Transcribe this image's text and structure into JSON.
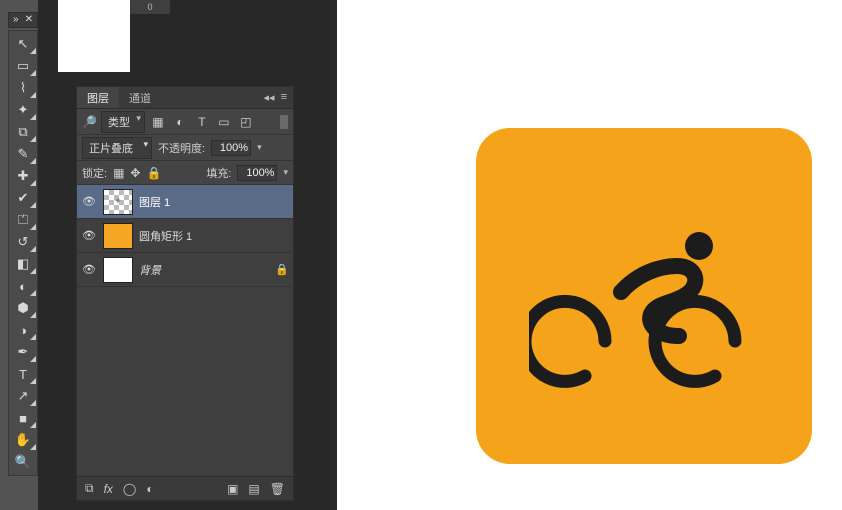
{
  "tabstrip": {
    "close": "✕",
    "arrow": "»"
  },
  "ruler": {
    "mark": "0"
  },
  "tools": [
    {
      "name": "move-tool",
      "glyph": "↖",
      "sub": true
    },
    {
      "name": "marquee-tool",
      "glyph": "▭",
      "sub": true
    },
    {
      "name": "lasso-tool",
      "glyph": "⌇",
      "sub": true
    },
    {
      "name": "wand-tool",
      "glyph": "✦",
      "sub": true
    },
    {
      "name": "crop-tool",
      "glyph": "⧉",
      "sub": true
    },
    {
      "name": "eyedropper-tool",
      "glyph": "✎",
      "sub": true
    },
    {
      "name": "healing-tool",
      "glyph": "✚",
      "sub": true
    },
    {
      "name": "brush-tool",
      "glyph": "✔",
      "sub": true
    },
    {
      "name": "stamp-tool",
      "glyph": "⏍",
      "sub": true
    },
    {
      "name": "history-brush-tool",
      "glyph": "↺",
      "sub": true
    },
    {
      "name": "eraser-tool",
      "glyph": "◧",
      "sub": true
    },
    {
      "name": "gradient-tool",
      "glyph": "◐",
      "sub": true
    },
    {
      "name": "blur-tool",
      "glyph": "⬢",
      "sub": true
    },
    {
      "name": "dodge-tool",
      "glyph": "◑",
      "sub": true
    },
    {
      "name": "pen-tool",
      "glyph": "✒",
      "sub": true
    },
    {
      "name": "type-tool",
      "glyph": "T",
      "sub": true
    },
    {
      "name": "path-select-tool",
      "glyph": "↗",
      "sub": true
    },
    {
      "name": "shape-tool",
      "glyph": "■",
      "sub": true
    },
    {
      "name": "hand-tool",
      "glyph": "✋",
      "sub": true
    },
    {
      "name": "zoom-tool",
      "glyph": "🔍",
      "sub": false
    }
  ],
  "layersPanel": {
    "tabs": {
      "layers": "图层",
      "channels": "通道"
    },
    "flyout": {
      "collapse": "◂◂",
      "menu": "≡"
    },
    "filter": {
      "kindLabel": "类型",
      "icons": {
        "pixel": "▦",
        "adjust": "◐",
        "type": "T",
        "shape": "▭",
        "smart": "◰"
      }
    },
    "blend": {
      "mode": "正片叠底",
      "opacityLabel": "不透明度:",
      "opacityValue": "100%"
    },
    "lock": {
      "label": "锁定:",
      "icons": {
        "pixels": "▦",
        "position": "✥",
        "all": "🔒"
      },
      "fillLabel": "填充:",
      "fillValue": "100%"
    },
    "layers": [
      {
        "name": "图层 1",
        "thumb": "checker",
        "selected": true,
        "locked": false
      },
      {
        "name": "圆角矩形 1",
        "thumb": "orange",
        "selected": false,
        "locked": false
      },
      {
        "name": "背景",
        "thumb": "white",
        "selected": false,
        "locked": true
      }
    ],
    "footer": {
      "link": "⧉",
      "fx": "fx",
      "mask": "◯",
      "adjust": "◐",
      "group": "▣",
      "new": "▤",
      "trash": "🗑"
    }
  },
  "artwork": {
    "color": "#f4a31a"
  }
}
